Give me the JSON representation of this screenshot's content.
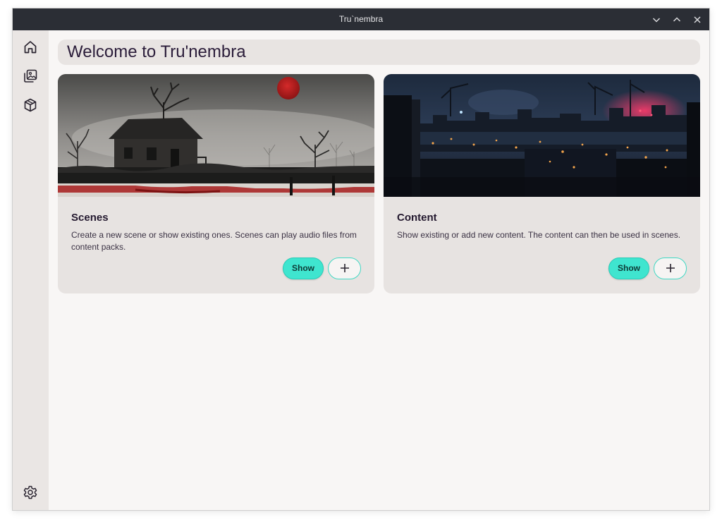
{
  "window": {
    "title": "Tru`nembra",
    "controls": [
      "chevron-down-icon",
      "chevron-up-icon",
      "close-icon"
    ]
  },
  "sidebar": {
    "items": [
      {
        "icon": "home-icon"
      },
      {
        "icon": "image-gallery-icon"
      },
      {
        "icon": "cube-icon"
      }
    ],
    "footer_icon": "gear-icon"
  },
  "main": {
    "heading": "Welcome to Tru'nembra",
    "cards": [
      {
        "title": "Scenes",
        "description": "Create a new scene or show existing ones. Scenes can play audio files from content packs.",
        "show_label": "Show",
        "add_icon": "plus-icon"
      },
      {
        "title": "Content",
        "description": "Show existing or add new content. The content can then be used in scenes.",
        "show_label": "Show",
        "add_icon": "plus-icon"
      }
    ]
  },
  "colors": {
    "titlebar": "#2b2e35",
    "sidebar": "#eae6e4",
    "background": "#f8f6f5",
    "card": "#e7e3e1",
    "accent": "#3fe5cf"
  }
}
